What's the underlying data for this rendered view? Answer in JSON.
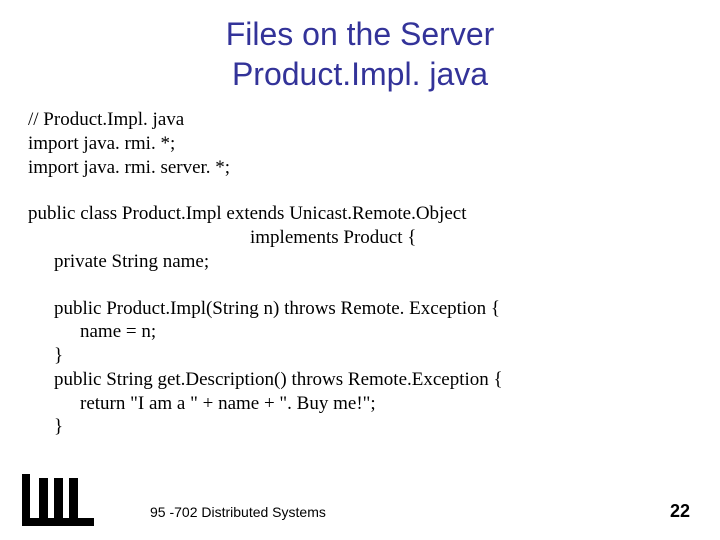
{
  "title_line1": "Files on the Server",
  "title_line2": "Product.Impl. java",
  "code": {
    "l1": "// Product.Impl. java",
    "l2": "import java. rmi. *;",
    "l3": "import java. rmi. server. *;",
    "l4": "public class Product.Impl extends Unicast.Remote.Object",
    "l5": "implements Product {",
    "l6": "private String name;",
    "l7": "public Product.Impl(String n) throws Remote. Exception {",
    "l8": "name = n;",
    "l9": "}",
    "l10": "public String get.Description() throws Remote.Exception {",
    "l11": "return \"I am a \" + name + \". Buy me!\";",
    "l12": "}"
  },
  "footer": "95 -702 Distributed Systems",
  "page_number": "22"
}
